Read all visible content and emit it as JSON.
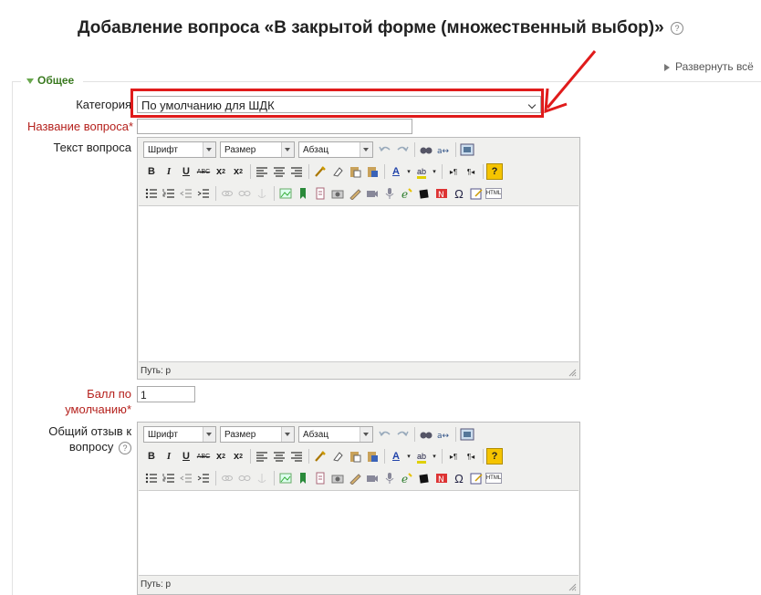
{
  "page_title": "Добавление вопроса «В закрытой форме (множественный выбор)»",
  "expand_all": "Развернуть всё",
  "section_legend": "Общее",
  "fields": {
    "category": {
      "label": "Категория",
      "value": "По умолчанию для ШДК"
    },
    "question_name": {
      "label": "Название вопроса",
      "required_mark": "*",
      "value": ""
    },
    "question_text": {
      "label": "Текст вопроса",
      "path": "Путь: p"
    },
    "default_mark": {
      "label_line1": "Балл по",
      "label_line2": "умолчанию",
      "required_mark": "*",
      "value": "1"
    },
    "general_feedback": {
      "label_line1": "Общий отзыв к",
      "label_line2": "вопросу",
      "path": "Путь: p"
    }
  },
  "toolbar": {
    "font": "Шрифт",
    "size": "Размер",
    "format": "Абзац",
    "bold": "B",
    "italic": "I",
    "underline": "U",
    "strike": "ABC",
    "subscript": "x",
    "superscript": "x",
    "forecolor": "A",
    "backcolor": "ab",
    "ltr": "▸¶",
    "rtl": "¶◂",
    "help": "?",
    "omega": "Ω",
    "html": "HTML"
  },
  "colors": {
    "highlight": "#e01b1b",
    "required": "#b5211d",
    "legend": "#3a7a20"
  }
}
